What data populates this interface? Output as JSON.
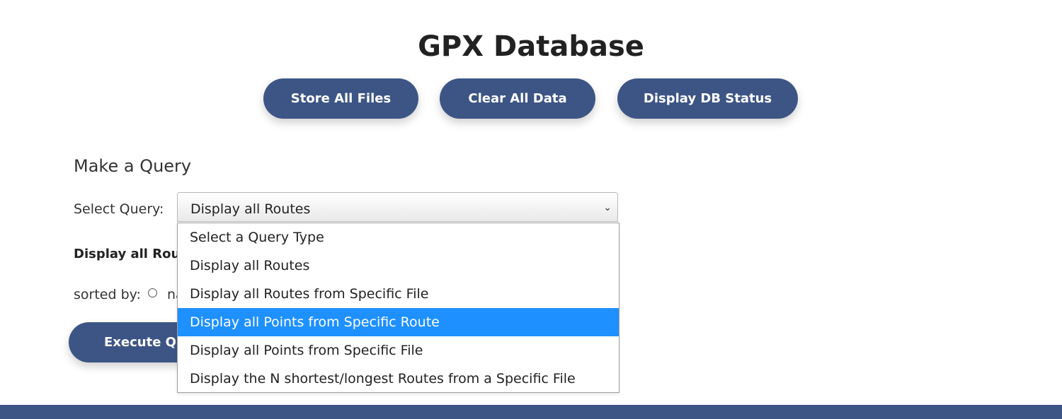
{
  "header": {
    "title": "GPX Database",
    "buttons": {
      "store": "Store All Files",
      "clear": "Clear All Data",
      "status": "Display DB Status"
    }
  },
  "query": {
    "section_title": "Make a Query",
    "select_label": "Select Query:",
    "selected_value": "Display all Routes",
    "options": [
      "Select a Query Type",
      "Display all Routes",
      "Display all Routes from Specific File",
      "Display all Points from Specific Route",
      "Display all Points from Specific File",
      "Display the N shortest/longest Routes from a Specific File"
    ],
    "highlighted_index": 3,
    "form_heading": "Display all Routes",
    "sorted_by_label": "sorted by:",
    "radio_text": "na",
    "execute_label": "Execute Query"
  },
  "colors": {
    "primary": "#3d5585",
    "highlight": "#1e90ff"
  }
}
